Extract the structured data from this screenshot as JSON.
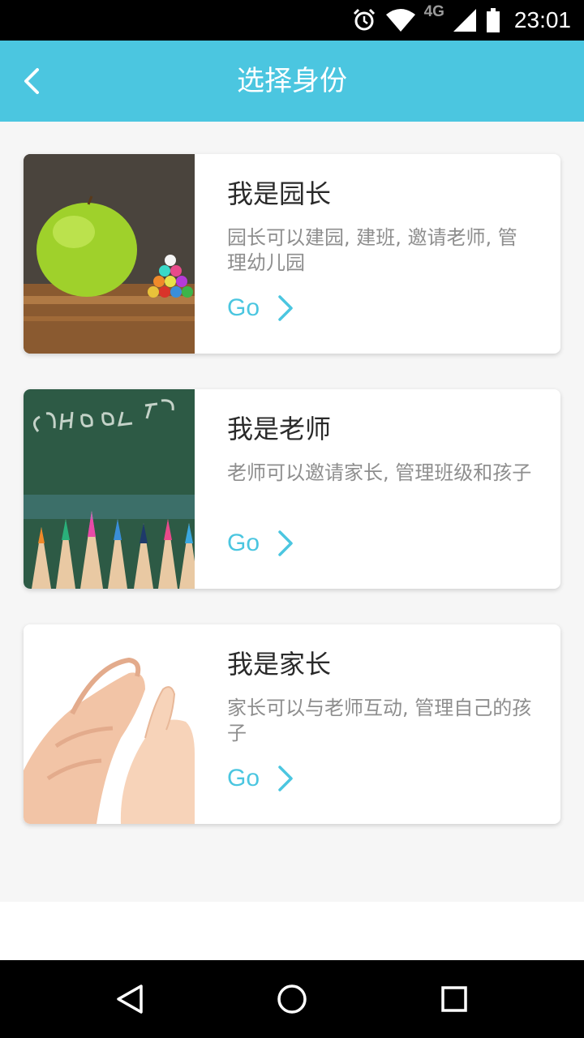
{
  "status_bar": {
    "time": "23:01",
    "network": "4G"
  },
  "header": {
    "title": "选择身份"
  },
  "roles": [
    {
      "title": "我是园长",
      "description": "园长可以建园, 建班, 邀请老师, 管理幼儿园",
      "go_label": "Go",
      "image": "apple-and-pencils"
    },
    {
      "title": "我是老师",
      "description": "老师可以邀请家长, 管理班级和孩子",
      "go_label": "Go",
      "image": "school-chalkboard-pencils"
    },
    {
      "title": "我是家长",
      "description": "家长可以与老师互动, 管理自己的孩子",
      "go_label": "Go",
      "image": "parent-child-hands"
    }
  ],
  "colors": {
    "accent": "#4bc6e0",
    "background": "#f6f6f6"
  },
  "nav": {
    "icons": [
      "back-triangle-icon",
      "home-circle-icon",
      "recents-square-icon"
    ]
  }
}
